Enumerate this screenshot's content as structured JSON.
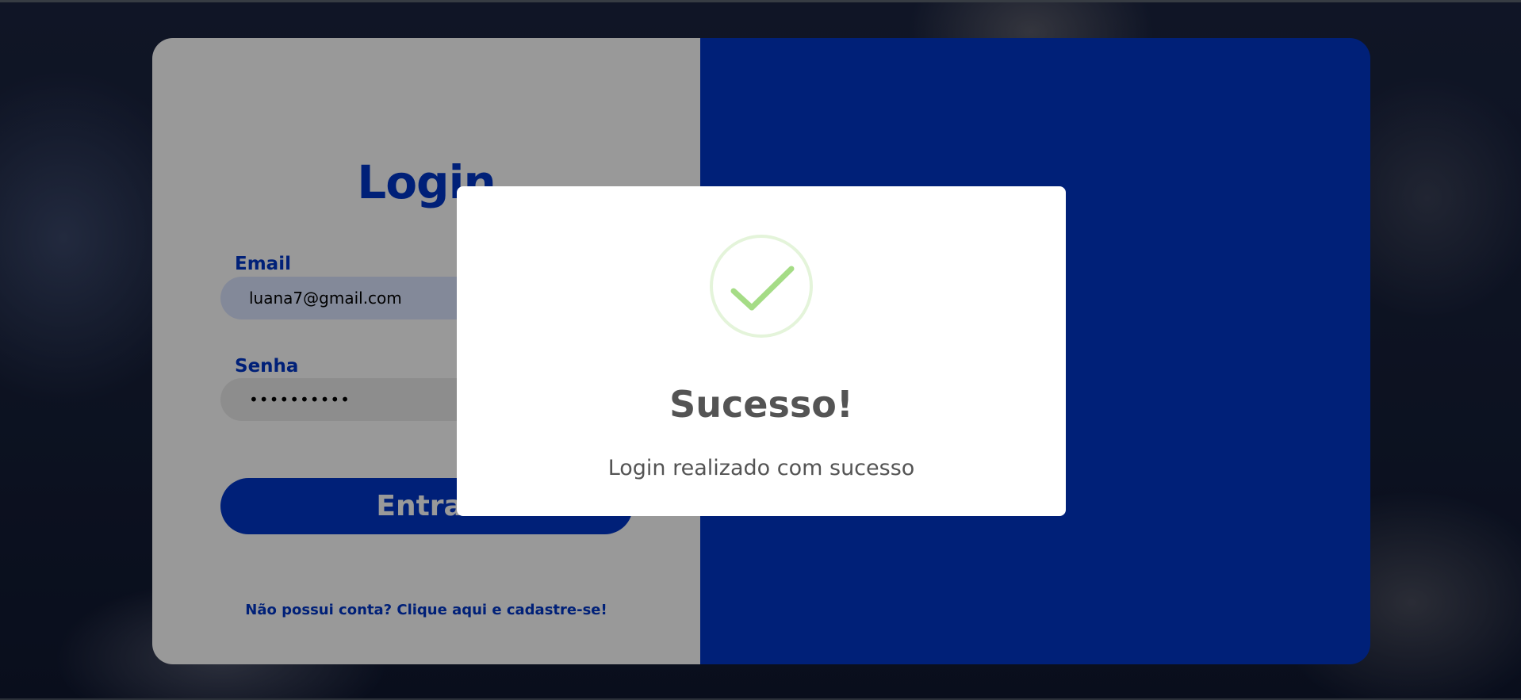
{
  "login": {
    "title": "Login",
    "email_label": "Email",
    "email_value": "luana7@gmail.com",
    "password_label": "Senha",
    "password_value": "••••••••••",
    "submit_label": "Entrar",
    "signup_link": "Não possui conta? Clique aqui e cadastre-se!"
  },
  "dialog": {
    "icon": "success-check-icon",
    "title": "Sucesso!",
    "message": "Login realizado com sucesso"
  },
  "colors": {
    "brand_blue": "#0036c8",
    "success_green": "#a5dc86",
    "dialog_text": "#545454"
  }
}
